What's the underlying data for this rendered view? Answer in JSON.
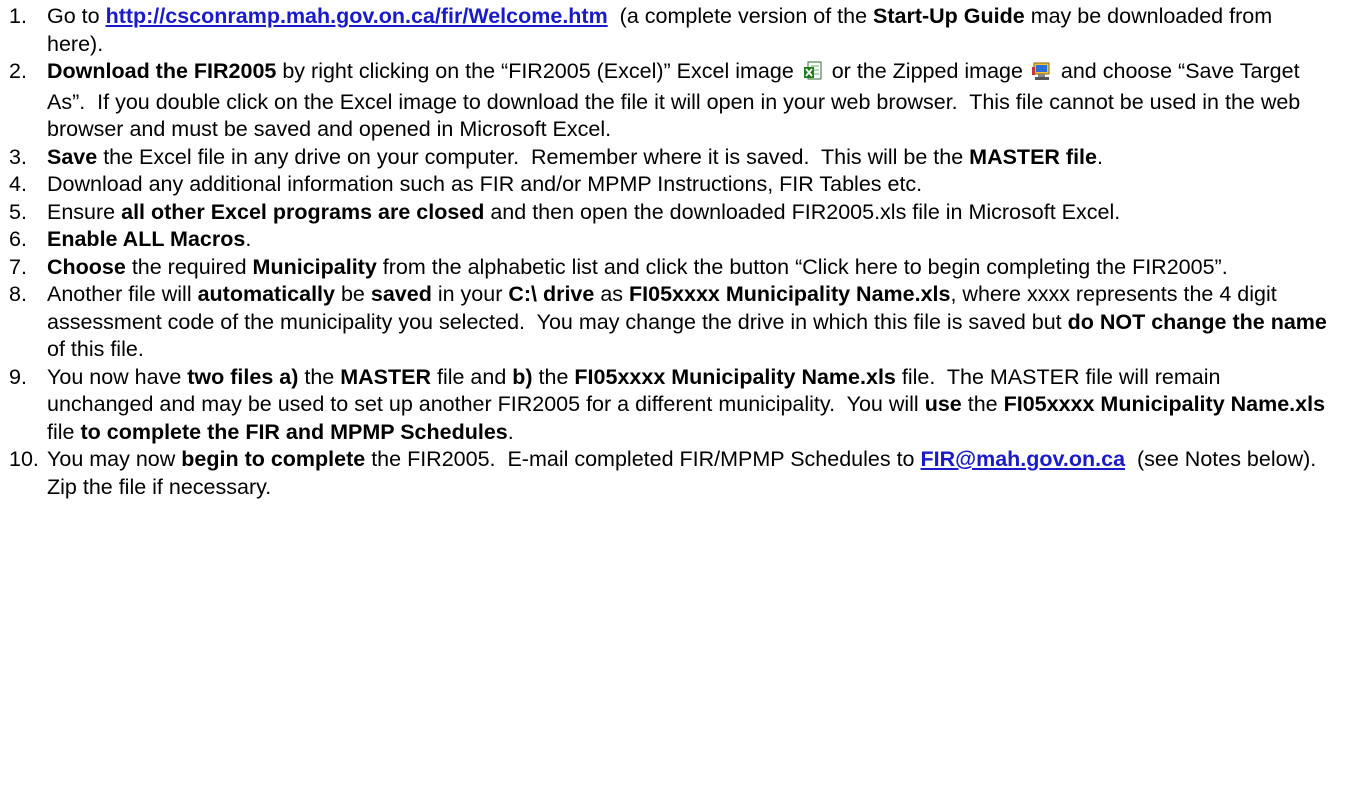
{
  "link_color": "#1a1ac8",
  "icons": {
    "excel": "excel-file-icon",
    "zip": "zipped-file-icon"
  },
  "steps": [
    {
      "num": "1.",
      "parts": [
        {
          "t": "Go to "
        },
        {
          "t": "http://csconramp.mah.gov.on.ca/fir/Welcome.htm",
          "link": true
        },
        {
          "t": "  (a complete version of the "
        },
        {
          "t": "Start-Up Guide",
          "b": true
        },
        {
          "t": " may be downloaded from here)."
        }
      ]
    },
    {
      "num": "2.",
      "parts": [
        {
          "t": "Download the FIR2005",
          "b": true
        },
        {
          "t": " by right clicking on the “FIR2005 (Excel)” Excel image "
        },
        {
          "icon": "excel"
        },
        {
          "t": " or the Zipped image "
        },
        {
          "icon": "zip"
        },
        {
          "t": " and choose “Save Target As”.  If you double click on the Excel image to download the file it will open in your web browser.  This file cannot be used in the web browser and must be saved and opened in Microsoft Excel."
        }
      ]
    },
    {
      "num": "3.",
      "parts": [
        {
          "t": "Save",
          "b": true
        },
        {
          "t": " the Excel file in any drive on your computer.  Remember where it is saved.  This will be the "
        },
        {
          "t": "MASTER file",
          "b": true
        },
        {
          "t": "."
        }
      ]
    },
    {
      "num": "4.",
      "parts": [
        {
          "t": "Download any additional information such as FIR and/or MPMP Instructions, FIR Tables etc."
        }
      ]
    },
    {
      "num": "5.",
      "parts": [
        {
          "t": "Ensure "
        },
        {
          "t": "all other Excel programs are closed",
          "b": true
        },
        {
          "t": " and then open the downloaded FIR2005.xls file in Microsoft Excel."
        }
      ]
    },
    {
      "num": "6.",
      "parts": [
        {
          "t": "Enable ALL Macros",
          "b": true
        },
        {
          "t": "."
        }
      ]
    },
    {
      "num": "7.",
      "parts": [
        {
          "t": "Choose",
          "b": true
        },
        {
          "t": " the required "
        },
        {
          "t": "Municipality",
          "b": true
        },
        {
          "t": " from the alphabetic list and click the button “Click here to begin completing the FIR2005”."
        }
      ]
    },
    {
      "num": "8.",
      "parts": [
        {
          "t": "Another file will "
        },
        {
          "t": "automatically",
          "b": true
        },
        {
          "t": " be "
        },
        {
          "t": "saved",
          "b": true
        },
        {
          "t": " in your "
        },
        {
          "t": "C:\\ drive",
          "b": true
        },
        {
          "t": " as "
        },
        {
          "t": "FI05xxxx Municipality Name.xls",
          "b": true
        },
        {
          "t": ", where xxxx represents the 4 digit assessment code of the municipality you selected.  You may change the drive in which this file is saved but "
        },
        {
          "t": "do NOT change the name",
          "b": true
        },
        {
          "t": " of this file."
        }
      ]
    },
    {
      "num": "9.",
      "parts": [
        {
          "t": "You now have "
        },
        {
          "t": "two files a)",
          "b": true
        },
        {
          "t": " the "
        },
        {
          "t": "MASTER",
          "b": true
        },
        {
          "t": " file and "
        },
        {
          "t": "b)",
          "b": true
        },
        {
          "t": " the "
        },
        {
          "t": "FI05xxxx Municipality Name.xls",
          "b": true
        },
        {
          "t": " file.  The MASTER file will remain unchanged and may be used to set up another FIR2005 for a different municipality.  You will "
        },
        {
          "t": "use",
          "b": true
        },
        {
          "t": " the "
        },
        {
          "t": "FI05xxxx Municipality Name.xls",
          "b": true
        },
        {
          "t": " file "
        },
        {
          "t": "to complete the FIR and MPMP Schedules",
          "b": true
        },
        {
          "t": "."
        }
      ]
    },
    {
      "num": "10.",
      "parts": [
        {
          "t": "You may now "
        },
        {
          "t": "begin to complete",
          "b": true
        },
        {
          "t": " the FIR2005.  E-mail completed FIR/MPMP Schedules to "
        },
        {
          "t": "FIR@mah.gov.on.ca",
          "link": true
        },
        {
          "t": "  (see Notes below).  Zip the file if necessary."
        }
      ]
    }
  ]
}
